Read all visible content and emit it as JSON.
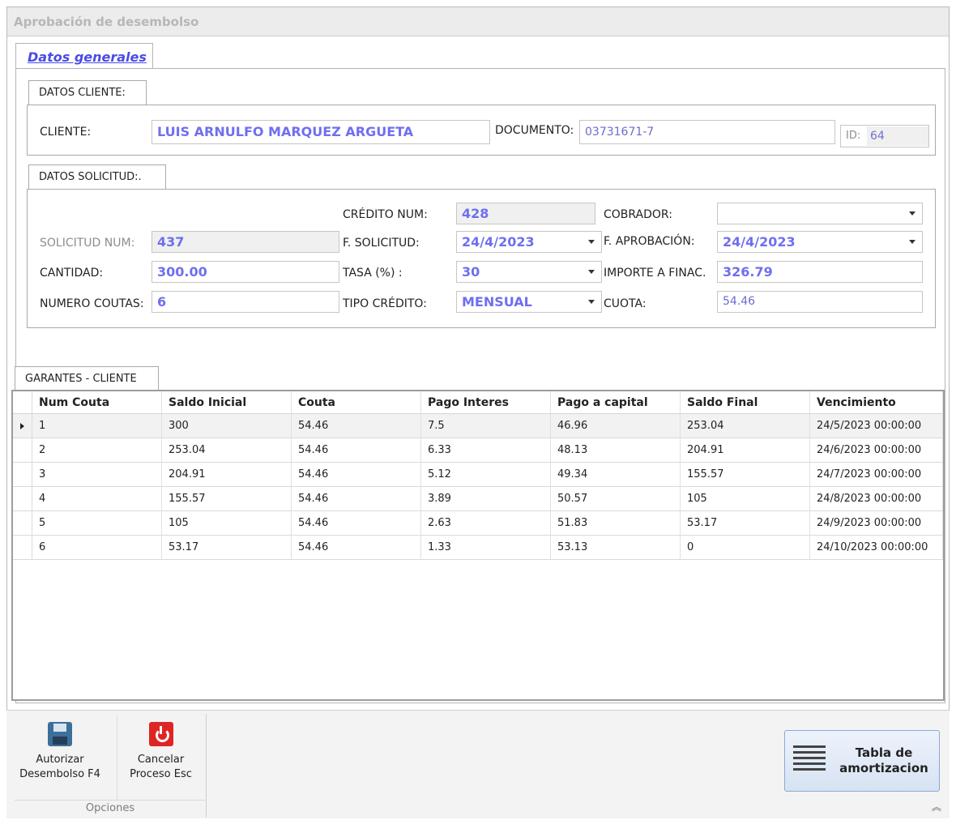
{
  "window": {
    "title": "Aprobación de desembolso"
  },
  "tabs": {
    "main": "Datos generales",
    "cliente": "DATOS CLIENTE:",
    "solicitud": "DATOS SOLICITUD:.",
    "garantes": "GARANTES - CLIENTE"
  },
  "cliente": {
    "label": "CLIENTE:",
    "value": "LUIS ARNULFO MARQUEZ ARGUETA",
    "documento_label": "DOCUMENTO:",
    "documento_value": "03731671-7",
    "id_label": "ID:",
    "id_value": "64"
  },
  "solicitud": {
    "credito_label": "CRÉDITO NUM:",
    "credito_value": "428",
    "cobrador_label": "COBRADOR:",
    "cobrador_value": "",
    "solicitud_label": "SOLICITUD NUM:",
    "solicitud_value": "437",
    "f_solicitud_label": "F. SOLICITUD:",
    "f_solicitud_value": "24/4/2023",
    "f_aprobacion_label": "F. APROBACIÓN:",
    "f_aprobacion_value": "24/4/2023",
    "cantidad_label": "CANTIDAD:",
    "cantidad_value": "300.00",
    "tasa_label": "TASA (%) :",
    "tasa_value": "30",
    "importe_label": "IMPORTE A FINAC.",
    "importe_value": "326.79",
    "cuotas_label": "NUMERO COUTAS:",
    "cuotas_value": "6",
    "tipo_label": "TIPO CRÉDITO:",
    "tipo_value": "MENSUAL",
    "cuota_label": "CUOTA:",
    "cuota_value": "54.46"
  },
  "grid": {
    "columns": [
      "Num Couta",
      "Saldo Inicial",
      "Couta",
      "Pago Interes",
      "Pago a capital",
      "Saldo Final",
      "Vencimiento"
    ],
    "rows": [
      [
        "1",
        "300",
        "54.46",
        "7.5",
        "46.96",
        "253.04",
        "24/5/2023 00:00:00"
      ],
      [
        "2",
        "253.04",
        "54.46",
        "6.33",
        "48.13",
        "204.91",
        "24/6/2023 00:00:00"
      ],
      [
        "3",
        "204.91",
        "54.46",
        "5.12",
        "49.34",
        "155.57",
        "24/7/2023 00:00:00"
      ],
      [
        "4",
        "155.57",
        "54.46",
        "3.89",
        "50.57",
        "105",
        "24/8/2023 00:00:00"
      ],
      [
        "5",
        "105",
        "54.46",
        "2.63",
        "51.83",
        "53.17",
        "24/9/2023 00:00:00"
      ],
      [
        "6",
        "53.17",
        "54.46",
        "1.33",
        "53.13",
        "0",
        "24/10/2023 00:00:00"
      ]
    ]
  },
  "ribbon": {
    "autorizar_line1": "Autorizar",
    "autorizar_line2": "Desembolso F4",
    "cancelar_line1": "Cancelar",
    "cancelar_line2": "Proceso Esc",
    "group_label": "Opciones",
    "amort_line1": "Tabla de",
    "amort_line2": "amortizacion"
  },
  "icons": {
    "save": "save-icon",
    "power": "power-icon",
    "table": "table-lines-icon",
    "collapse": "chevron-up-double-icon"
  }
}
